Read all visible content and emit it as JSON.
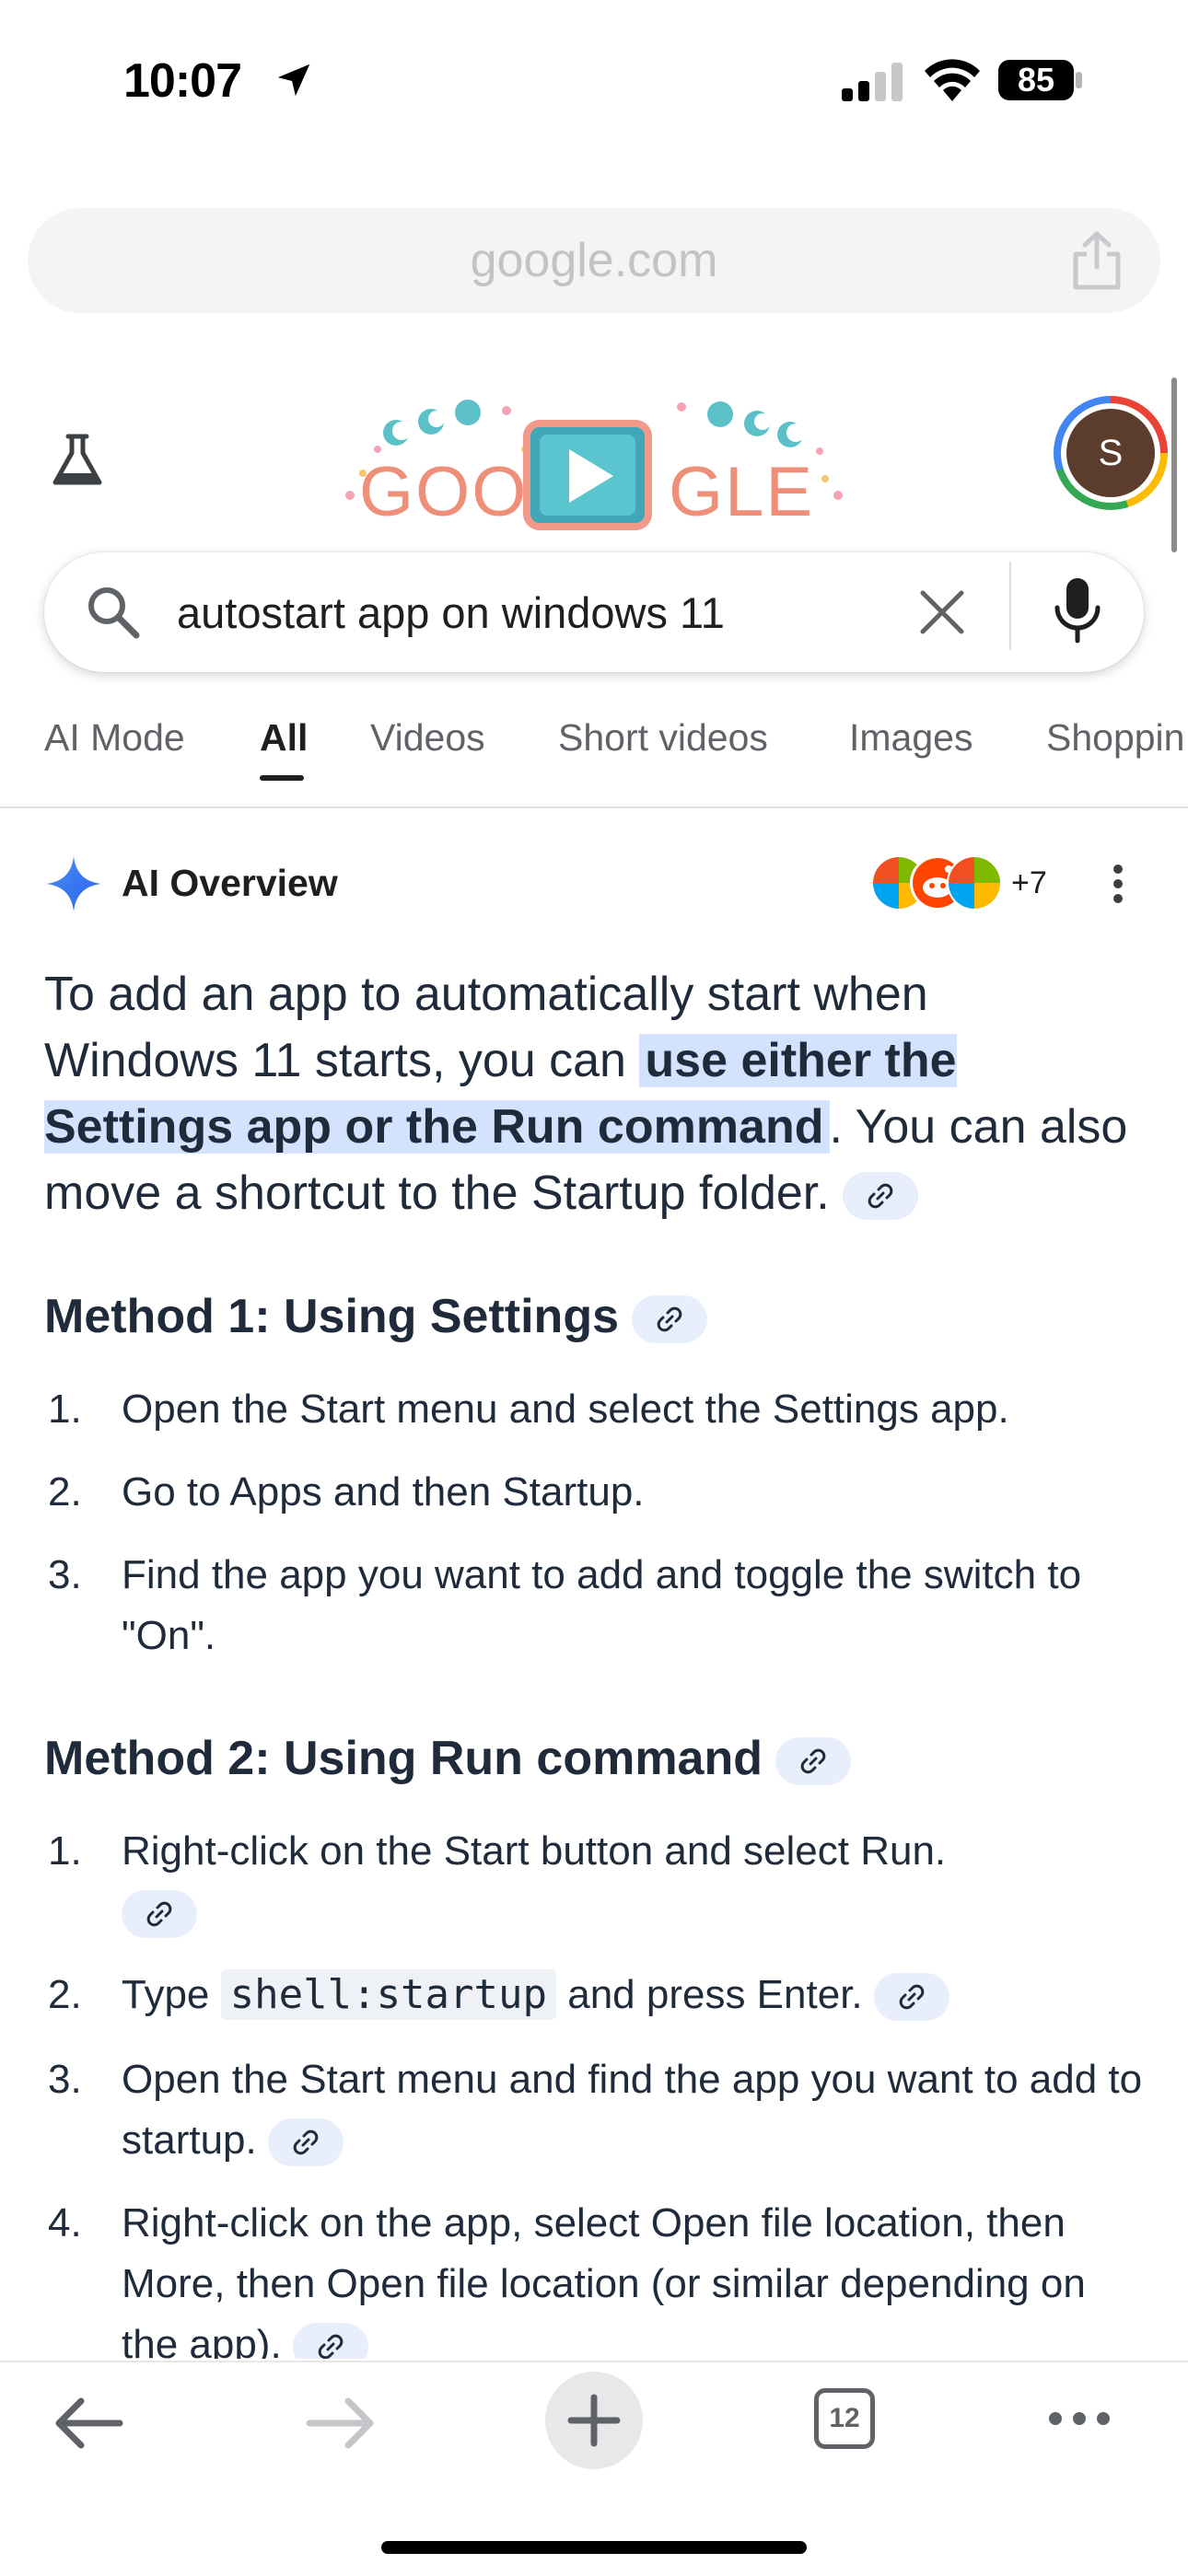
{
  "status_bar": {
    "time": "10:07",
    "battery": "85"
  },
  "browser": {
    "url": "google.com",
    "tab_count": "12"
  },
  "profile": {
    "initial": "S"
  },
  "search": {
    "query": "autostart app on windows 11"
  },
  "tabs": [
    "AI Mode",
    "All",
    "Videos",
    "Short videos",
    "Images",
    "Shoppin"
  ],
  "active_tab": "All",
  "ai_overview": {
    "title": "AI Overview",
    "source_count": "+7",
    "intro_before": "To add an app to automatically start when Windows 11 starts, you can ",
    "intro_highlight": "use either the Settings app or the Run command",
    "intro_after": ". You can also move a shortcut to the Startup folder.",
    "method1": {
      "heading": "Method 1: Using Settings",
      "steps": [
        "Open the Start menu and select the Settings app.",
        "Go to Apps and then Startup.",
        "Find the app you want to add and toggle the switch to \"On\"."
      ]
    },
    "method2": {
      "heading": "Method 2: Using Run command",
      "step1": "Right-click on the Start button and select Run.",
      "step2_before": "Type ",
      "step2_code": "shell:startup",
      "step2_after": " and press Enter.",
      "step3": "Open the Start menu and find the app you want to add to startup.",
      "step4": "Right-click on the app, select Open file location, then More, then Open file location (or similar depending on the app)."
    },
    "numbers": [
      "1.",
      "2.",
      "3.",
      "4."
    ]
  },
  "colors": {
    "highlight": "#d3e3fd",
    "link_chip": "#e8eefb",
    "text": "#1f2a3a"
  }
}
